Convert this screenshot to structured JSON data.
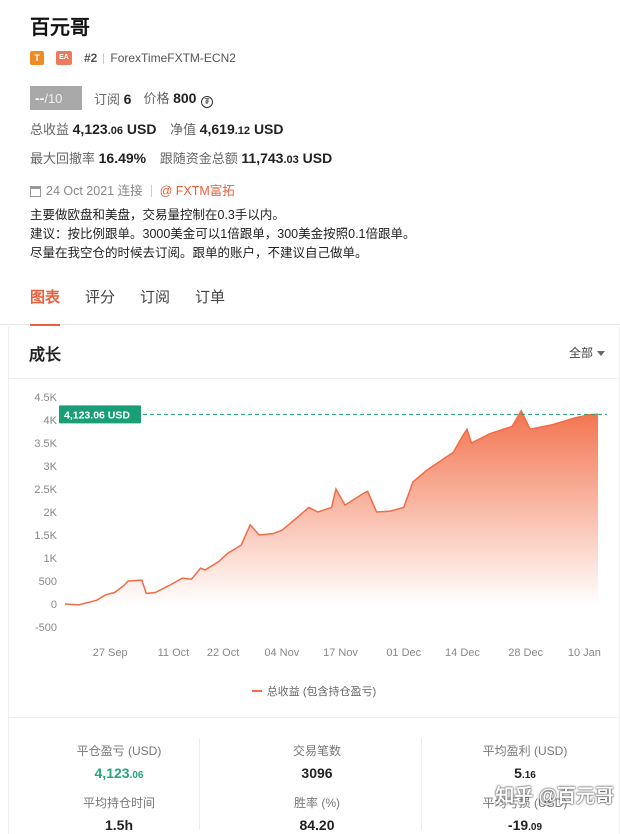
{
  "title": "百元哥",
  "tags": {
    "t": "T",
    "ea": "EA"
  },
  "rank": "#2",
  "broker": "ForexTimeFXTM-ECN2",
  "score": {
    "value": "--",
    "max": "/10"
  },
  "subscriptions": {
    "label": "订阅",
    "value": "6"
  },
  "price": {
    "label": "价格",
    "value": "800",
    "coin": "₮"
  },
  "total_profit": {
    "label": "总收益",
    "main": "4,123",
    "dec": ".06",
    "unit": "USD"
  },
  "net_value": {
    "label": "净值",
    "main": "4,619",
    "dec": ".12",
    "unit": "USD"
  },
  "max_drawdown": {
    "label": "最大回撤率",
    "value": "16.49%"
  },
  "follow_funds": {
    "label": "跟随资金总额",
    "main": "11,743",
    "dec": ".03",
    "unit": "USD"
  },
  "connect": {
    "date": "24 Oct 2021 连接",
    "broker_link": "@ FXTM富拓"
  },
  "description": [
    "主要做欧盘和美盘，交易量控制在0.3手以内。",
    "建议：按比例跟单。3000美金可以1倍跟单，300美金按照0.1倍跟单。",
    "尽量在我空仓的时候去订阅。跟单的账户，不建议自己做单。"
  ],
  "tabs": [
    "图表",
    "评分",
    "订阅",
    "订单"
  ],
  "active_tab": 0,
  "growth": {
    "title": "成长",
    "range": "全部"
  },
  "colors": {
    "accent": "#e8603c",
    "line": "#f26c45",
    "label_bg": "#1a9e78",
    "green": "#24a57d"
  },
  "chart_data": {
    "type": "area",
    "ylim": [
      -500,
      4500
    ],
    "yticks": [
      {
        "v": 4500,
        "label": "4.5K"
      },
      {
        "v": 4000,
        "label": "4K"
      },
      {
        "v": 3500,
        "label": "3.5K"
      },
      {
        "v": 3000,
        "label": "3K"
      },
      {
        "v": 2500,
        "label": "2.5K"
      },
      {
        "v": 2000,
        "label": "2K"
      },
      {
        "v": 1500,
        "label": "1.5K"
      },
      {
        "v": 1000,
        "label": "1K"
      },
      {
        "v": 500,
        "label": "500"
      },
      {
        "v": 0,
        "label": "0"
      },
      {
        "v": -500,
        "label": "-500"
      }
    ],
    "xlim": [
      "2021-09-17",
      "2022-01-15"
    ],
    "xticks": [
      {
        "d": "2021-09-27",
        "label": "27 Sep"
      },
      {
        "d": "2021-10-11",
        "label": "11 Oct"
      },
      {
        "d": "2021-10-22",
        "label": "22 Oct"
      },
      {
        "d": "2021-11-04",
        "label": "04 Nov"
      },
      {
        "d": "2021-11-17",
        "label": "17 Nov"
      },
      {
        "d": "2021-12-01",
        "label": "01 Dec"
      },
      {
        "d": "2021-12-14",
        "label": "14 Dec"
      },
      {
        "d": "2021-12-28",
        "label": "28 Dec"
      },
      {
        "d": "2022-01-10",
        "label": "10 Jan"
      }
    ],
    "series": [
      {
        "name": "总收益 (包含持仓盈亏)",
        "points": [
          [
            "2021-09-17",
            0
          ],
          [
            "2021-09-20",
            -20
          ],
          [
            "2021-09-24",
            80
          ],
          [
            "2021-09-26",
            200
          ],
          [
            "2021-09-28",
            250
          ],
          [
            "2021-09-30",
            400
          ],
          [
            "2021-10-01",
            500
          ],
          [
            "2021-10-04",
            520
          ],
          [
            "2021-10-05",
            230
          ],
          [
            "2021-10-07",
            250
          ],
          [
            "2021-10-10",
            400
          ],
          [
            "2021-10-13",
            560
          ],
          [
            "2021-10-15",
            540
          ],
          [
            "2021-10-17",
            780
          ],
          [
            "2021-10-18",
            740
          ],
          [
            "2021-10-21",
            920
          ],
          [
            "2021-10-23",
            1100
          ],
          [
            "2021-10-26",
            1280
          ],
          [
            "2021-10-28",
            1720
          ],
          [
            "2021-10-30",
            1500
          ],
          [
            "2021-11-02",
            1530
          ],
          [
            "2021-11-04",
            1600
          ],
          [
            "2021-11-07",
            1850
          ],
          [
            "2021-11-10",
            2100
          ],
          [
            "2021-11-12",
            2000
          ],
          [
            "2021-11-15",
            2100
          ],
          [
            "2021-11-16",
            2500
          ],
          [
            "2021-11-18",
            2150
          ],
          [
            "2021-11-22",
            2400
          ],
          [
            "2021-11-23",
            2450
          ],
          [
            "2021-11-25",
            2000
          ],
          [
            "2021-11-28",
            2020
          ],
          [
            "2021-12-01",
            2100
          ],
          [
            "2021-12-03",
            2650
          ],
          [
            "2021-12-06",
            2900
          ],
          [
            "2021-12-09",
            3100
          ],
          [
            "2021-12-12",
            3300
          ],
          [
            "2021-12-14",
            3650
          ],
          [
            "2021-12-15",
            3800
          ],
          [
            "2021-12-16",
            3500
          ],
          [
            "2021-12-20",
            3700
          ],
          [
            "2021-12-25",
            3860
          ],
          [
            "2021-12-27",
            4200
          ],
          [
            "2021-12-29",
            3800
          ],
          [
            "2022-01-03",
            3900
          ],
          [
            "2022-01-08",
            4050
          ],
          [
            "2022-01-11",
            4110
          ],
          [
            "2022-01-13",
            4123.06
          ]
        ]
      }
    ],
    "last_value_label": "4,123.06 USD",
    "grid": false
  },
  "legend_label": "总收益 (包含持仓盈亏)",
  "summary": [
    {
      "label": "平仓盈亏 (USD)",
      "main": "4,123",
      "dec": ".06",
      "green": true
    },
    {
      "label": "交易笔数",
      "main": "3096",
      "dec": "",
      "green": false
    },
    {
      "label": "平均盈利 (USD)",
      "main": "5",
      "dec": ".16",
      "green": false
    },
    {
      "label": "平均持仓时间",
      "main": "1.5h",
      "dec": "",
      "green": false
    },
    {
      "label": "胜率 (%)",
      "main": "84.20",
      "dec": "",
      "green": false
    },
    {
      "label": "平均亏损 (USD)",
      "main": "-19",
      "dec": ".09",
      "green": false
    }
  ],
  "watermark": "知乎 @百元哥"
}
